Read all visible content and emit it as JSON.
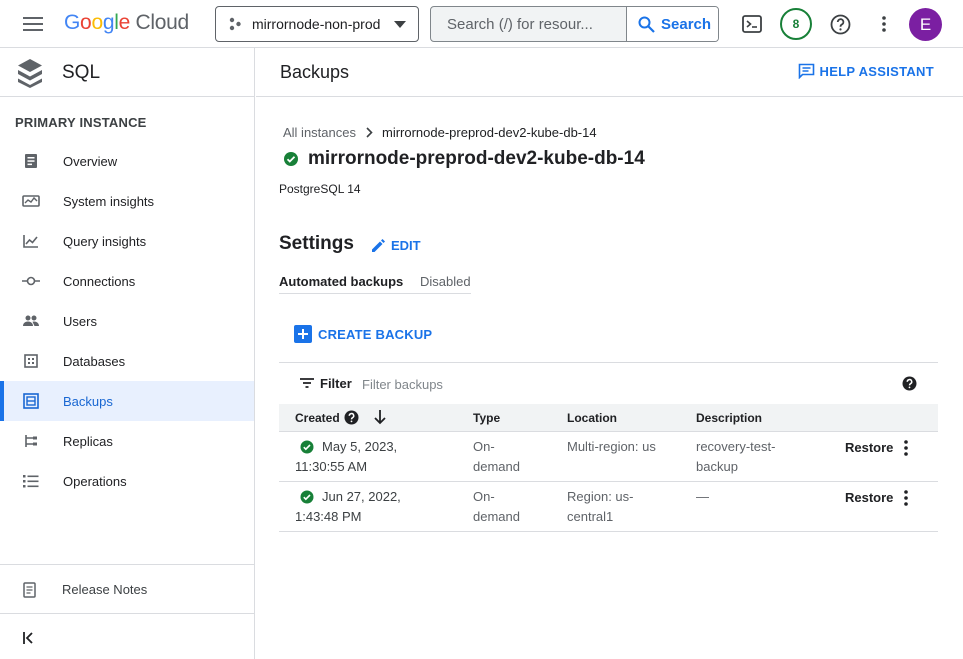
{
  "topbar": {
    "logo": {
      "google": "Google",
      "cloud": "Cloud"
    },
    "project": "mirrornode-non-prod",
    "search": {
      "placeholder": "Search (/) for resour...",
      "button": "Search"
    },
    "notifications_count": "8",
    "avatar_letter": "E"
  },
  "sidebar": {
    "product": "SQL",
    "section": "PRIMARY INSTANCE",
    "items": [
      {
        "label": "Overview",
        "icon": "overview-icon"
      },
      {
        "label": "System insights",
        "icon": "system-insights-icon"
      },
      {
        "label": "Query insights",
        "icon": "query-insights-icon"
      },
      {
        "label": "Connections",
        "icon": "connections-icon"
      },
      {
        "label": "Users",
        "icon": "users-icon"
      },
      {
        "label": "Databases",
        "icon": "databases-icon"
      },
      {
        "label": "Backups",
        "icon": "backups-icon",
        "active": true
      },
      {
        "label": "Replicas",
        "icon": "replicas-icon"
      },
      {
        "label": "Operations",
        "icon": "operations-icon"
      }
    ],
    "release_notes": "Release Notes"
  },
  "header": {
    "title": "Backups",
    "help": "HELP ASSISTANT"
  },
  "breadcrumb": {
    "root": "All instances",
    "current": "mirrornode-preprod-dev2-kube-db-14"
  },
  "instance": {
    "name": "mirrornode-preprod-dev2-kube-db-14",
    "version": "PostgreSQL 14",
    "status": "running"
  },
  "settings": {
    "title": "Settings",
    "edit": "EDIT",
    "automated_label": "Automated backups",
    "automated_value": "Disabled"
  },
  "actions": {
    "create_backup": "CREATE BACKUP"
  },
  "filter": {
    "label": "Filter",
    "placeholder": "Filter backups"
  },
  "table": {
    "headers": {
      "created": "Created",
      "type": "Type",
      "location": "Location",
      "description": "Description"
    },
    "rows": [
      {
        "created_1": "May 5, 2023,",
        "created_2": "11:30:55 AM",
        "type_1": "On-",
        "type_2": "demand",
        "location_1": "Multi-region: us",
        "location_2": "",
        "description_1": "recovery-test-",
        "description_2": "backup",
        "action": "Restore"
      },
      {
        "created_1": "Jun 27, 2022,",
        "created_2": "1:43:48 PM",
        "type_1": "On-",
        "type_2": "demand",
        "location_1": "Region: us-",
        "location_2": "central1",
        "description_1": "—",
        "description_2": "",
        "action": "Restore"
      }
    ]
  },
  "colors": {
    "accent": "#1a73e8",
    "success": "#188038",
    "avatar": "#7b1fa2"
  }
}
